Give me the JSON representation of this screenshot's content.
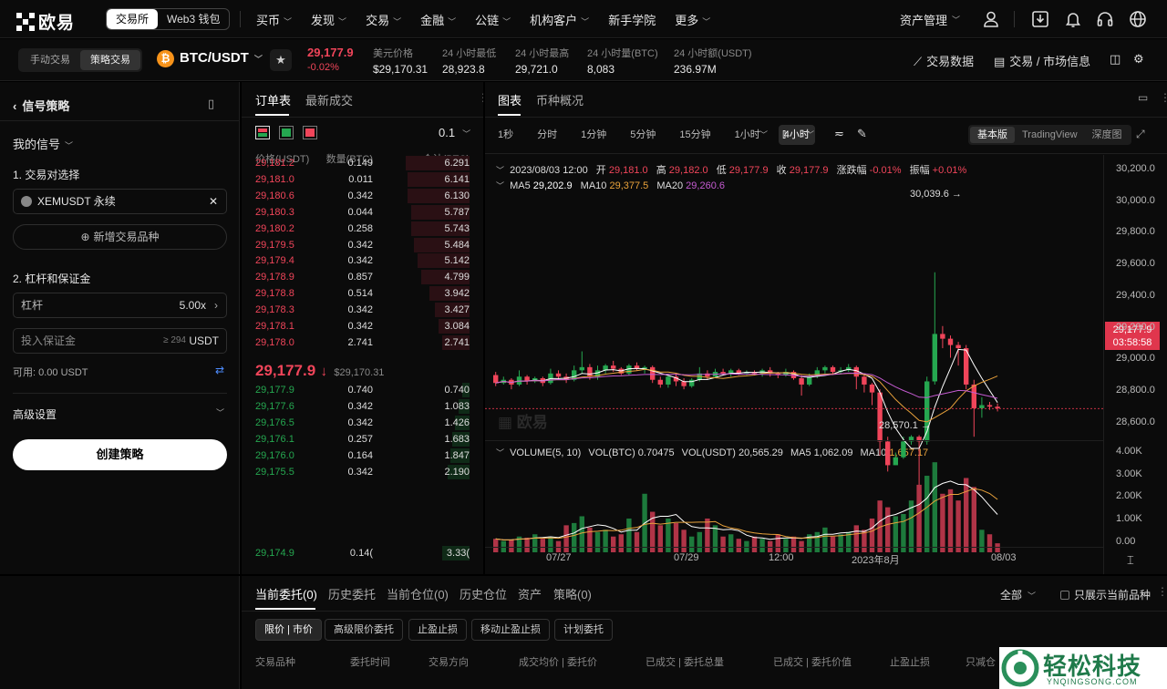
{
  "nav": {
    "logo": "欧易",
    "segments": [
      "交易所",
      "Web3 钱包"
    ],
    "items": [
      "买币",
      "发现",
      "交易",
      "金融",
      "公链",
      "机构客户",
      "新手学院",
      "更多"
    ],
    "asset": "资产管理"
  },
  "subbar": {
    "modes": [
      "手动交易",
      "策略交易"
    ],
    "pair": "BTC/USDT",
    "price": "29,177.9",
    "change": "-0.02%",
    "stats": [
      {
        "label": "美元价格",
        "value": "$29,170.31"
      },
      {
        "label": "24 小时最低",
        "value": "28,923.8"
      },
      {
        "label": "24 小时最高",
        "value": "29,721.0"
      },
      {
        "label": "24 小时量(BTC)",
        "value": "8,083"
      },
      {
        "label": "24 小时额(USDT)",
        "value": "236.97M"
      }
    ],
    "trade_data": "交易数据",
    "market_info": "交易 / 市场信息"
  },
  "left": {
    "title": "信号策略",
    "my_signal": "我的信号",
    "step1": "1. 交易对选择",
    "pair_value": "XEMUSDT 永续",
    "add_pair": "新增交易品种",
    "step2": "2. 杠杆和保证金",
    "leverage_label": "杠杆",
    "leverage_value": "5.00x",
    "margin_placeholder": "投入保证金",
    "margin_min": "≥ 294",
    "margin_unit": "USDT",
    "available": "可用: 0.00 USDT",
    "advanced": "高级设置",
    "create": "创建策略"
  },
  "book": {
    "tabs": [
      "订单表",
      "最新成交"
    ],
    "precision": "0.1",
    "headers": [
      "价格(USDT)",
      "数量(BTC)",
      "合计(BTC)"
    ],
    "asks": [
      [
        "29,181.2",
        "0.149",
        "6.291"
      ],
      [
        "29,181.0",
        "0.011",
        "6.141"
      ],
      [
        "29,180.6",
        "0.342",
        "6.130"
      ],
      [
        "29,180.3",
        "0.044",
        "5.787"
      ],
      [
        "29,180.2",
        "0.258",
        "5.743"
      ],
      [
        "29,179.5",
        "0.342",
        "5.484"
      ],
      [
        "29,179.4",
        "0.342",
        "5.142"
      ],
      [
        "29,178.9",
        "0.857",
        "4.799"
      ],
      [
        "29,178.8",
        "0.514",
        "3.942"
      ],
      [
        "29,178.3",
        "0.342",
        "3.427"
      ],
      [
        "29,178.1",
        "0.342",
        "3.084"
      ],
      [
        "29,178.0",
        "2.741",
        "2.741"
      ]
    ],
    "mid_price": "29,177.9",
    "mid_arrow": "↓",
    "mid_usd": "$29,170.31",
    "bids": [
      [
        "29,177.9",
        "0.740",
        "0.740"
      ],
      [
        "29,177.6",
        "0.342",
        "1.083"
      ],
      [
        "29,176.5",
        "0.342",
        "1.426"
      ],
      [
        "29,176.1",
        "0.257",
        "1.683"
      ],
      [
        "29,176.0",
        "0.164",
        "1.847"
      ],
      [
        "29,175.5",
        "0.342",
        "2.190"
      ]
    ],
    "last_bid": [
      "29,174.9",
      "0.14(",
      "3.33("
    ]
  },
  "chart": {
    "tabs": [
      "图表",
      "币种概况"
    ],
    "intervals": [
      "1秒",
      "分时",
      "1分钟",
      "5分钟",
      "15分钟",
      "1小时",
      "4小时"
    ],
    "views": [
      "基本版",
      "TradingView",
      "深度图"
    ],
    "ohlc_line": {
      "date": "2023/08/03 12:00",
      "open_label": "开",
      "open": "29,181.0",
      "high_label": "高",
      "high": "29,182.0",
      "low_label": "低",
      "low": "29,177.9",
      "close_label": "收",
      "close": "29,177.9",
      "chg_label": "涨跌幅",
      "chg": "-0.01%",
      "amp_label": "振幅",
      "amp": "+0.01%"
    },
    "ma_line": {
      "ma5_label": "MA5",
      "ma5": "29,202.9",
      "ma10_label": "MA10",
      "ma10": "29,377.5",
      "ma20_label": "MA20",
      "ma20": "29,260.6"
    },
    "price_axis": [
      "30,200.0",
      "30,000.0",
      "29,800.0",
      "29,600.0",
      "29,400.0",
      "29,200.0",
      "29,000.0",
      "28,800.0",
      "28,600.0"
    ],
    "price_tag": "29,177.9",
    "countdown": "03:58:58",
    "high_mark": "30,039.6",
    "low_mark": "28,570.1",
    "chart_watermark": "欧易",
    "vol_line": {
      "label": "VOLUME(5, 10)",
      "btc_label": "VOL(BTC)",
      "btc": "0.70475",
      "usdt_label": "VOL(USDT)",
      "usdt": "20,565.29",
      "ma5_label": "MA5",
      "ma5": "1,062.09",
      "ma10_label": "MA10",
      "ma10": "1,657.17"
    },
    "vol_axis": [
      "4.00K",
      "3.00K",
      "2.00K",
      "1.00K",
      "0.00"
    ],
    "x_labels": [
      "07/27",
      "07/29",
      "12:00",
      "2023年8月",
      "08/03"
    ],
    "colors": {
      "up": "#25a750",
      "down": "#f0455a",
      "ma5": "#ffffff",
      "ma10": "#e9a23b",
      "ma20": "#c45bd1"
    }
  },
  "bottom": {
    "tabs": [
      "当前委托(0)",
      "历史委托",
      "当前仓位(0)",
      "历史仓位",
      "资产",
      "策略(0)"
    ],
    "filter": "全部",
    "only_current": "只展示当前品种",
    "chips": [
      "限价 | 市价",
      "高级限价委托",
      "止盈止损",
      "移动止盈止损",
      "计划委托"
    ],
    "columns": [
      "交易品种",
      "委托时间",
      "交易方向",
      "成交均价 | 委托价",
      "已成交 | 委托总量",
      "已成交 | 委托价值",
      "止盈止损",
      "只减仓"
    ]
  },
  "watermark": {
    "text": "轻松科技",
    "url": "YNQINGSONG.COM"
  }
}
